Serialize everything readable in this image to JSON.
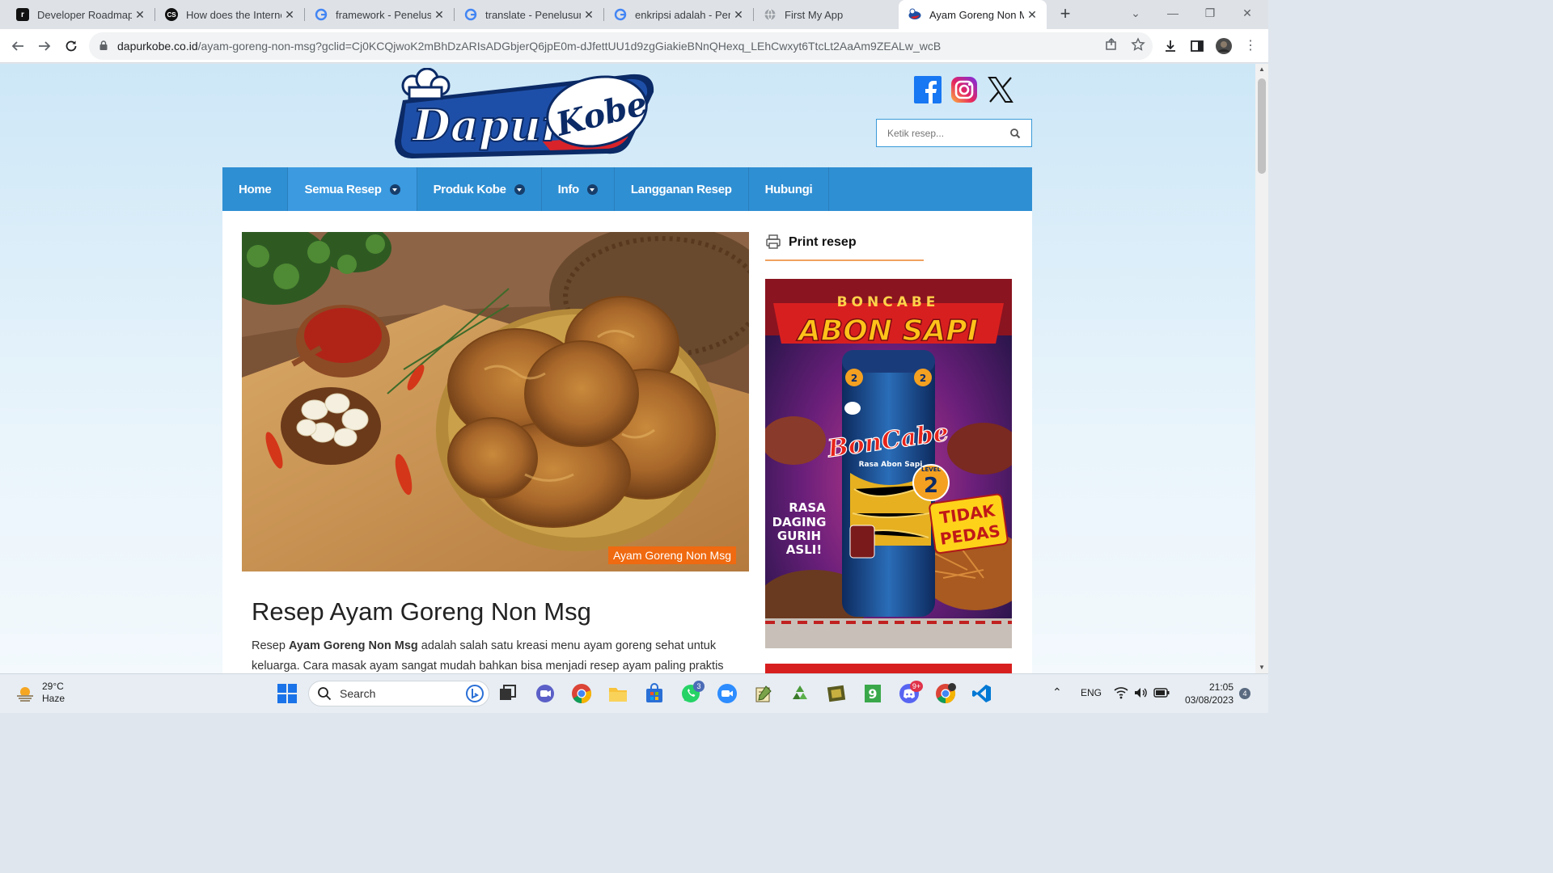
{
  "browser": {
    "tabs": [
      {
        "label": "Developer Roadmaps",
        "favicon": "roadmap-icon",
        "active": false
      },
      {
        "label": "How does the Interne",
        "favicon": "cs-icon",
        "active": false
      },
      {
        "label": "framework - Penelusu",
        "favicon": "google-icon",
        "active": false
      },
      {
        "label": "translate - Penelusura",
        "favicon": "google-icon",
        "active": false
      },
      {
        "label": "enkripsi adalah - Pen",
        "favicon": "google-icon",
        "active": false
      },
      {
        "label": "First My App",
        "favicon": "globe-icon",
        "active": false
      },
      {
        "label": "Ayam Goreng Non M",
        "favicon": "dapurkobe-icon",
        "active": true
      }
    ],
    "new_tab_label": "+",
    "url_host": "dapurkobe.co.id",
    "url_path": "/ayam-goreng-non-msg?gclid=Cj0KCQjwoK2mBhDzARIsADGbjerQ6jpE0m-dJfettUU1d9zgGiakieBNnQHexq_LEhCwxyt6TtcLt2AaAm9ZEALw_wcB"
  },
  "site": {
    "logo_text_1": "Dapur",
    "logo_text_2": "Kobe",
    "search_placeholder": "Ketik resep...",
    "nav": [
      {
        "label": "Home",
        "dropdown": false
      },
      {
        "label": "Semua Resep",
        "dropdown": true
      },
      {
        "label": "Produk Kobe",
        "dropdown": true
      },
      {
        "label": "Info",
        "dropdown": true
      },
      {
        "label": "Langganan Resep",
        "dropdown": false
      },
      {
        "label": "Hubungi",
        "dropdown": false
      }
    ],
    "hero_caption": "Ayam Goreng Non Msg",
    "recipe_title": "Resep Ayam Goreng Non Msg",
    "intro_prefix": "Resep ",
    "intro_bold": "Ayam Goreng Non Msg",
    "intro_rest": " adalah salah satu kreasi menu ayam goreng sehat untuk keluarga. Cara masak ayam sangat mudah bahkan bisa menjadi resep ayam paling praktis",
    "print_label": "Print resep",
    "ad": {
      "brand": "BONCABE",
      "headline": "ABON SAPI",
      "product": "BonCabe",
      "product_sub": "Rasa Abon Sapi",
      "level_label": "LEVEL",
      "level": "2",
      "rasa_lines": [
        "RASA",
        "DAGING",
        "GURIH",
        "ASLI!"
      ],
      "tidak_lines": [
        "TIDAK",
        "PEDAS"
      ]
    },
    "colors": {
      "nav": "#2f8fd3",
      "accent": "#ef6a10",
      "ad_red": "#d81f1f"
    }
  },
  "taskbar": {
    "weather_temp": "29°C",
    "weather_desc": "Haze",
    "search_label": "Search",
    "whatsapp_badge": "3",
    "discord_badge": "9+",
    "language": "ENG",
    "time": "21:05",
    "date": "03/08/2023",
    "notification_count": "4"
  }
}
